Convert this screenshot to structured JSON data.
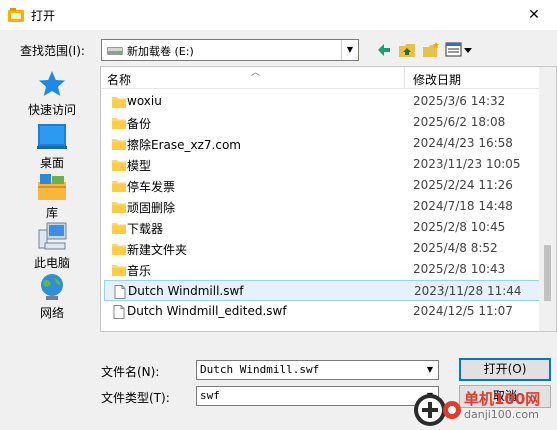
{
  "window": {
    "title": "打开"
  },
  "lookin": {
    "label": "查找范围(I):",
    "value": "新加载卷 (E:)"
  },
  "places": [
    {
      "label": "快速访问",
      "icon": "star-icon"
    },
    {
      "label": "桌面",
      "icon": "desktop-icon"
    },
    {
      "label": "库",
      "icon": "library-icon"
    },
    {
      "label": "此电脑",
      "icon": "computer-icon"
    },
    {
      "label": "网络",
      "icon": "network-icon"
    }
  ],
  "columns": {
    "name": "名称",
    "date": "修改日期"
  },
  "files": [
    {
      "name": "woxiu",
      "date": "2025/3/6 14:32",
      "type": "folder"
    },
    {
      "name": "备份",
      "date": "2025/6/2 18:08",
      "type": "folder"
    },
    {
      "name": "擦除Erase_xz7.com",
      "date": "2024/4/23 16:58",
      "type": "folder"
    },
    {
      "name": "模型",
      "date": "2023/11/23 10:05",
      "type": "folder"
    },
    {
      "name": "停车发票",
      "date": "2025/2/24 11:26",
      "type": "folder"
    },
    {
      "name": "顽固删除",
      "date": "2024/7/18 14:48",
      "type": "folder"
    },
    {
      "name": "下载器",
      "date": "2025/2/8 10:45",
      "type": "folder"
    },
    {
      "name": "新建文件夹",
      "date": "2025/4/8 8:52",
      "type": "folder"
    },
    {
      "name": "音乐",
      "date": "2025/2/8 10:43",
      "type": "folder"
    },
    {
      "name": "Dutch Windmill.swf",
      "date": "2023/11/28 11:44",
      "type": "file",
      "selected": true
    },
    {
      "name": "Dutch Windmill_edited.swf",
      "date": "2024/12/5 11:07",
      "type": "file"
    }
  ],
  "filename": {
    "label": "文件名(N):",
    "value": "Dutch Windmill.swf"
  },
  "filetype": {
    "label": "文件类型(T):",
    "value": "swf"
  },
  "buttons": {
    "open": "打开(O)",
    "cancel": "取消"
  },
  "watermark": {
    "name": "单机100网",
    "url": "danji100.com"
  },
  "colors": {
    "folder": "#ffd766",
    "selection": "#e5f1fb",
    "focus": "#0078d7"
  }
}
